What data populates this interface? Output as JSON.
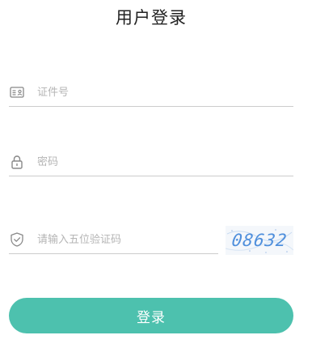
{
  "header": {
    "title": "用户登录"
  },
  "form": {
    "id_field": {
      "placeholder": "证件号",
      "value": "",
      "icon": "id-card-icon"
    },
    "password_field": {
      "placeholder": "密码",
      "value": "",
      "icon": "lock-icon"
    },
    "captcha_field": {
      "placeholder": "请输入五位验证码",
      "value": "",
      "icon": "shield-check-icon"
    },
    "captcha_image_text": "08632",
    "submit_label": "登录"
  },
  "colors": {
    "accent": "#4dc1ae",
    "icon": "#888888",
    "underline": "#cccccc",
    "captcha_text": "#4f8fdc"
  }
}
